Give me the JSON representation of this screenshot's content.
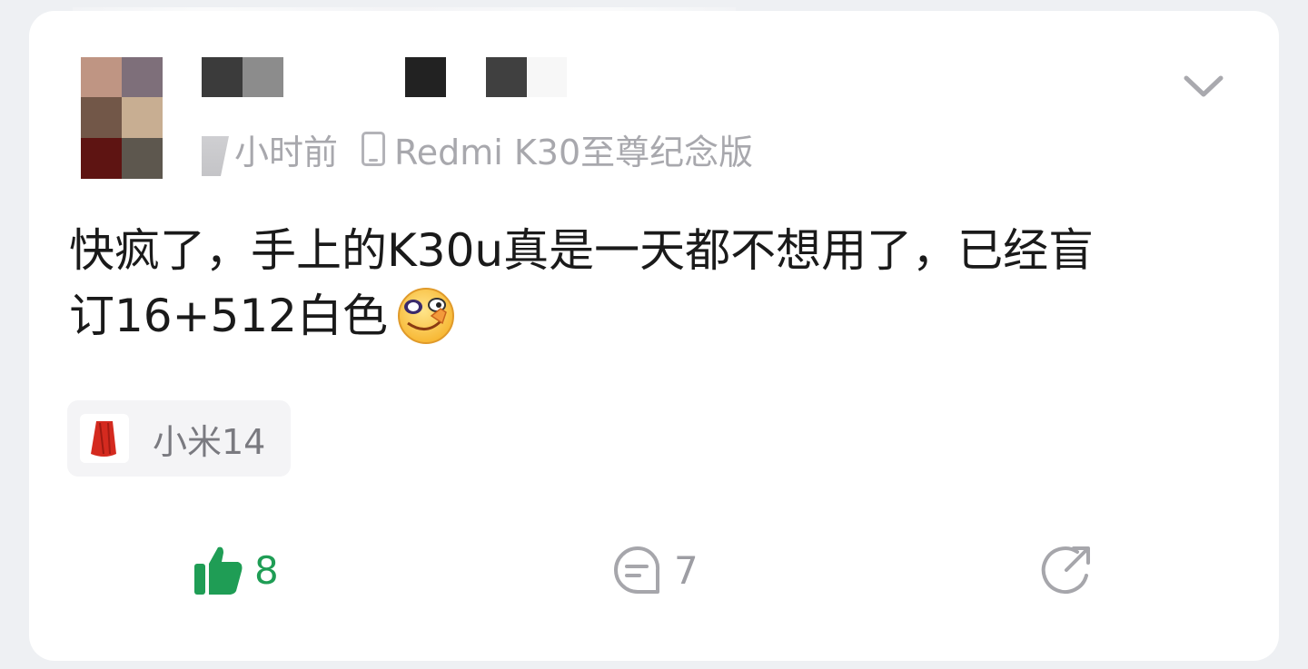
{
  "post": {
    "author": {
      "avatar_icon": "pixelated-avatar"
    },
    "meta": {
      "time": "小时前",
      "device_icon": "phone-icon",
      "device": "Redmi K30至尊纪念版"
    },
    "menu_icon": "chevron-down-icon",
    "content": {
      "line1": "快疯了，手上的K30u真是一天都不想用了，已经盲",
      "line2": "订16+512白色",
      "emoji_icon": "smirk-face-emoji-icon"
    },
    "tag": {
      "thumb_icon": "red-fabric-thumbnail",
      "label": "小米14"
    },
    "actions": {
      "like_icon": "thumbs-up-icon",
      "like_count": "8",
      "like_color": "#1f9d55",
      "comment_icon": "comment-icon",
      "comment_count": "7",
      "share_icon": "share-icon"
    }
  }
}
